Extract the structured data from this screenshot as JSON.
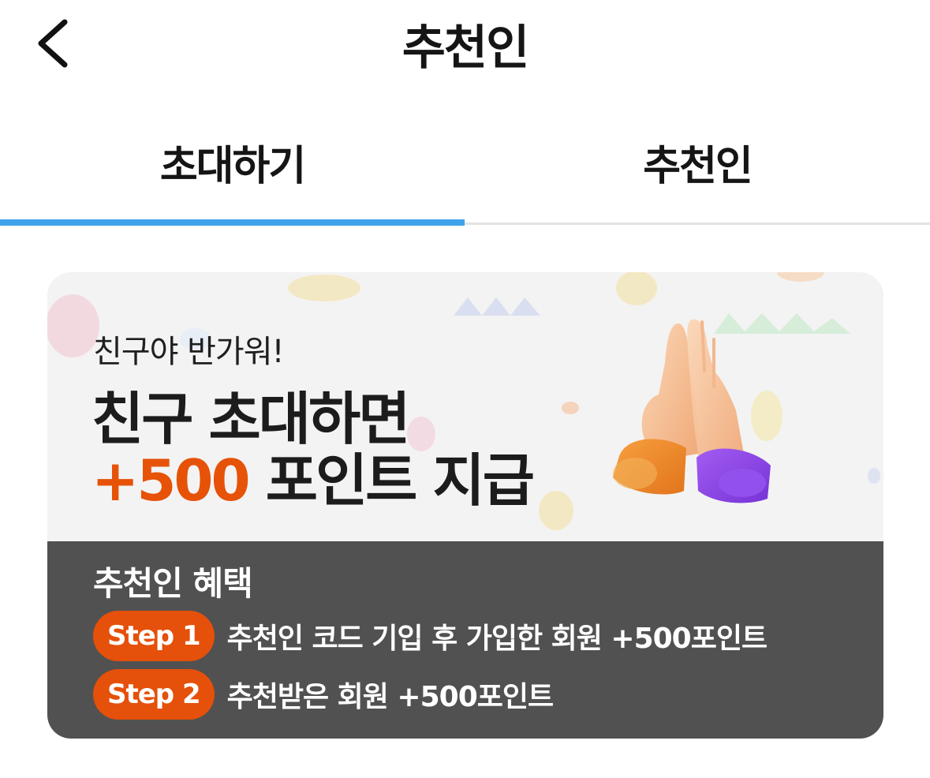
{
  "header": {
    "title": "추천인",
    "back_icon": "chevron-left-icon"
  },
  "tabs": [
    {
      "label": "초대하기",
      "active": true
    },
    {
      "label": "추천인",
      "active": false
    }
  ],
  "colors": {
    "tab_active_underline": "#3fa3ec",
    "accent_orange": "#e65208",
    "card_bottom_bg": "#515151",
    "card_top_bg": "#f3f3f3"
  },
  "banner": {
    "greeting": "친구야 반가워!",
    "headline_line1": "친구 초대하면",
    "headline_points": "+500",
    "headline_line2_rest": "포인트 지급",
    "illustration": "high-five-hands-icon"
  },
  "benefits": {
    "title": "추천인 혜택",
    "steps": [
      {
        "badge": "Step 1",
        "text": "추천인 코드 기입 후 가입한 회원 +500포인트"
      },
      {
        "badge": "Step 2",
        "text": "추천받은 회원 +500포인트"
      }
    ]
  }
}
